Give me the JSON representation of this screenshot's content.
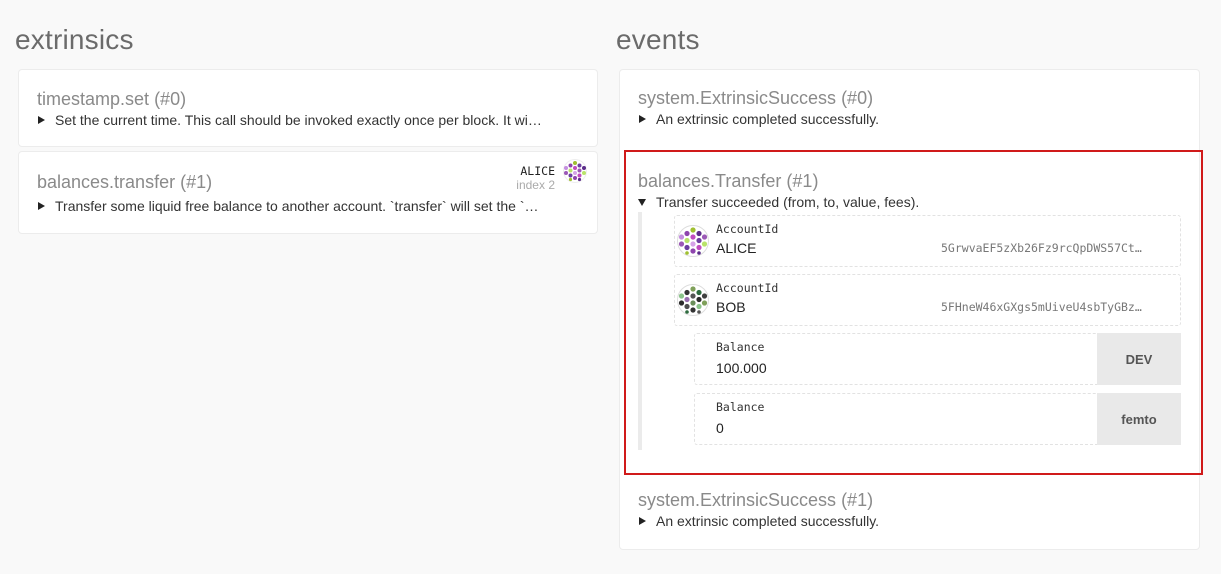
{
  "extrinsics": {
    "title": "extrinsics",
    "items": [
      {
        "name": "timestamp.set",
        "index": "(#0)",
        "description": "Set the current time. This call should be invoked exactly once per block. It wi…"
      },
      {
        "name": "balances.transfer",
        "index": "(#1)",
        "description": "Transfer some liquid free balance to another account. `transfer` will set the `…",
        "signer": {
          "name": "ALICE",
          "index": "index 2"
        }
      }
    ]
  },
  "events": {
    "title": "events",
    "items": [
      {
        "name": "system.ExtrinsicSuccess",
        "index": "(#0)",
        "description": "An extrinsic completed successfully."
      },
      {
        "name": "balances.Transfer",
        "index": "(#1)",
        "description": "Transfer succeeded (from, to, value, fees).",
        "params": [
          {
            "label": "AccountId",
            "value": "ALICE",
            "address": "5GrwvaEF5zXb26Fz9rcQpDWS57Ct…"
          },
          {
            "label": "AccountId",
            "value": "BOB",
            "address": "5FHneW46xGXgs5mUiveU4sbTyGBz…"
          },
          {
            "label": "Balance",
            "value": "100.000",
            "unit": "DEV"
          },
          {
            "label": "Balance",
            "value": "0",
            "unit": "femto"
          }
        ]
      },
      {
        "name": "system.ExtrinsicSuccess",
        "index": "(#1)",
        "description": "An extrinsic completed successfully."
      }
    ]
  },
  "colors": {
    "highlight": "#d01a1a",
    "background": "#f9f9f9",
    "card": "#ffffff"
  }
}
